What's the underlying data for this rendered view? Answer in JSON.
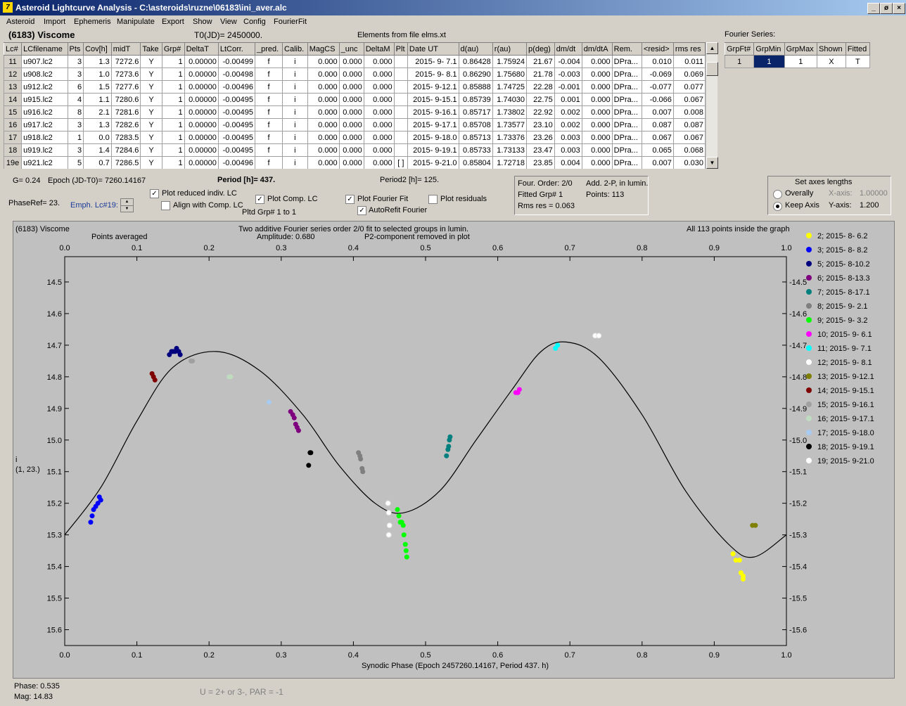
{
  "window": {
    "title": "Asteroid Lightcurve Analysis - C:\\asteroids\\ruzne\\06183\\ini_aver.alc",
    "app_icon": "7",
    "controls": [
      "_",
      "ø",
      "×"
    ]
  },
  "menu": [
    "Asteroid",
    "Import",
    "Ephemeris",
    "Manipulate",
    "Export",
    "Show",
    "View",
    "Config",
    "FourierFit"
  ],
  "header": {
    "asteroid_name": "(6183) Viscome",
    "t0": "T0(JD)= 2450000.",
    "elements": "Elements from file elms.xt",
    "fourier_series_label": "Fourier Series:"
  },
  "lc_table": {
    "columns": [
      "Lc#",
      "LCfilename",
      "Pts",
      "Cov[h]",
      "midT",
      "Take",
      "Grp#",
      "DeltaT",
      "LtCorr.",
      "_pred.",
      "Calib.",
      "MagCS",
      "_unc",
      "DeltaM",
      "Plt",
      "Date UT",
      "d(au)",
      "r(au)",
      "p(deg)",
      "dm/dt",
      "dm/dtA",
      "Rem.",
      "<resid>",
      "rms res"
    ],
    "rows": [
      [
        "11",
        "u907.lc2",
        "3",
        "1.3",
        "7272.6",
        "Y",
        "1",
        "0.00000",
        "-0.00499",
        "f",
        "i",
        "0.000",
        "0.000",
        "0.000",
        "",
        "2015- 9- 7.1",
        "0.86428",
        "1.75924",
        "21.67",
        "-0.004",
        "0.000",
        "DPra...",
        "0.010",
        "0.011"
      ],
      [
        "12",
        "u908.lc2",
        "3",
        "1.0",
        "7273.6",
        "Y",
        "1",
        "0.00000",
        "-0.00498",
        "f",
        "i",
        "0.000",
        "0.000",
        "0.000",
        "",
        "2015- 9- 8.1",
        "0.86290",
        "1.75680",
        "21.78",
        "-0.003",
        "0.000",
        "DPra...",
        "-0.069",
        "0.069"
      ],
      [
        "13",
        "u912.lc2",
        "6",
        "1.5",
        "7277.6",
        "Y",
        "1",
        "0.00000",
        "-0.00496",
        "f",
        "i",
        "0.000",
        "0.000",
        "0.000",
        "",
        "2015- 9-12.1",
        "0.85888",
        "1.74725",
        "22.28",
        "-0.001",
        "0.000",
        "DPra...",
        "-0.077",
        "0.077"
      ],
      [
        "14",
        "u915.lc2",
        "4",
        "1.1",
        "7280.6",
        "Y",
        "1",
        "0.00000",
        "-0.00495",
        "f",
        "i",
        "0.000",
        "0.000",
        "0.000",
        "",
        "2015- 9-15.1",
        "0.85739",
        "1.74030",
        "22.75",
        "0.001",
        "0.000",
        "DPra...",
        "-0.066",
        "0.067"
      ],
      [
        "15",
        "u916.lc2",
        "8",
        "2.1",
        "7281.6",
        "Y",
        "1",
        "0.00000",
        "-0.00495",
        "f",
        "i",
        "0.000",
        "0.000",
        "0.000",
        "",
        "2015- 9-16.1",
        "0.85717",
        "1.73802",
        "22.92",
        "0.002",
        "0.000",
        "DPra...",
        "0.007",
        "0.008"
      ],
      [
        "16",
        "u917.lc2",
        "3",
        "1.3",
        "7282.6",
        "Y",
        "1",
        "0.00000",
        "-0.00495",
        "f",
        "i",
        "0.000",
        "0.000",
        "0.000",
        "",
        "2015- 9-17.1",
        "0.85708",
        "1.73577",
        "23.10",
        "0.002",
        "0.000",
        "DPra...",
        "0.087",
        "0.087"
      ],
      [
        "17",
        "u918.lc2",
        "1",
        "0.0",
        "7283.5",
        "Y",
        "1",
        "0.00000",
        "-0.00495",
        "f",
        "i",
        "0.000",
        "0.000",
        "0.000",
        "",
        "2015- 9-18.0",
        "0.85713",
        "1.73376",
        "23.26",
        "0.003",
        "0.000",
        "DPra...",
        "0.067",
        "0.067"
      ],
      [
        "18",
        "u919.lc2",
        "3",
        "1.4",
        "7284.6",
        "Y",
        "1",
        "0.00000",
        "-0.00495",
        "f",
        "i",
        "0.000",
        "0.000",
        "0.000",
        "",
        "2015- 9-19.1",
        "0.85733",
        "1.73133",
        "23.47",
        "0.003",
        "0.000",
        "DPra...",
        "0.065",
        "0.068"
      ],
      [
        "19e",
        "u921.lc2",
        "5",
        "0.7",
        "7286.5",
        "Y",
        "1",
        "0.00000",
        "-0.00496",
        "f",
        "i",
        "0.000",
        "0.000",
        "0.000",
        "[ ]",
        "2015- 9-21.0",
        "0.85804",
        "1.72718",
        "23.85",
        "0.004",
        "0.000",
        "DPra...",
        "0.007",
        "0.030"
      ]
    ]
  },
  "fourier_table": {
    "columns": [
      "GrpFt#",
      "GrpMin",
      "GrpMax",
      "Shown",
      "Fitted"
    ],
    "row": [
      "1",
      "1",
      "1",
      "X",
      "T"
    ]
  },
  "params": {
    "g": "G= 0.24",
    "epoch": "Epoch (JD-T0)= 7260.14167",
    "period": "Period [h]= 437.",
    "period2": "Period2 [h]= 125.",
    "phaseref": "PhaseRef= 23.",
    "emph": "Emph. Lc#19:",
    "plot_reduced": "Plot reduced indiv. LC",
    "align": "Align with Comp. LC",
    "plot_comp": "Plot Comp. LC",
    "pltd_grp": "Pltd Grp#  1   to   1",
    "plot_fourier": "Plot Fourier Fit",
    "autorefit": "AutoRefit Fourier",
    "plot_resid": "Plot residuals"
  },
  "fit_info": {
    "four_order": "Four. Order:  2/0",
    "add": "Add. 2-P, in lumin.",
    "fitted_grp": "Fitted Grp# 1",
    "points": "Points: 113",
    "rms": "Rms res     = 0.063"
  },
  "axes_box": {
    "title": "Set axes lengths",
    "overally": "Overally",
    "keep_axis": "Keep Axis",
    "x_axis_label": "X-axis:",
    "x_axis_value": "1.00000",
    "y_axis_label": "Y-axis:",
    "y_axis_value": "1.200"
  },
  "plot": {
    "name": "(6183) Viscome",
    "points_averaged": "Points averaged",
    "info_line1": "Two additive Fourier series order 2/0 fit to selected groups in lumin.",
    "info_line2": "Amplitude: 0.680",
    "info_line3": "P2-component removed in plot",
    "all_inside": "All 113 points inside the graph",
    "y_label": "i",
    "y_label2": "(1, 23.)",
    "x_label": "Synodic Phase (Epoch 2457260.14167, Period 437. h)"
  },
  "status": {
    "phase": "Phase:  0.535",
    "mag": "Mag:   14.83",
    "u": "U = 2+ or 3-, PAR = -1"
  },
  "chart_data": {
    "type": "scatter",
    "title": "Two additive Fourier series order 2/0 fit to selected groups in lumin.",
    "xlabel": "Synodic Phase (Epoch 2457260.14167, Period 437. h)",
    "ylabel": "i",
    "xlim": [
      0,
      1
    ],
    "ylim": [
      15.65,
      14.42
    ],
    "y_inverted": true,
    "x_ticks": [
      "0.0",
      "0.1",
      "0.2",
      "0.3",
      "0.4",
      "0.5",
      "0.6",
      "0.7",
      "0.8",
      "0.9",
      "1.0"
    ],
    "y_ticks": [
      "14.5",
      "14.6",
      "14.7",
      "14.8",
      "14.9",
      "15.0",
      "15.1",
      "15.2",
      "15.3",
      "15.4",
      "15.5",
      "15.6"
    ],
    "legend_placement": "right",
    "fit_curve": {
      "mean": 15.045,
      "harmonics": [
        [
          -0.119,
          0.0
        ],
        [
          -0.145,
          0.0
        ],
        [
          0.0,
          0.0
        ]
      ],
      "comment_free": true
    },
    "fit_curve_points": [
      [
        0.0,
        15.3
      ],
      [
        0.05,
        15.15
      ],
      [
        0.1,
        14.94
      ],
      [
        0.15,
        14.77
      ],
      [
        0.21,
        14.72
      ],
      [
        0.27,
        14.78
      ],
      [
        0.33,
        14.92
      ],
      [
        0.38,
        15.08
      ],
      [
        0.43,
        15.2
      ],
      [
        0.47,
        15.23
      ],
      [
        0.52,
        15.16
      ],
      [
        0.57,
        15.0
      ],
      [
        0.62,
        14.84
      ],
      [
        0.66,
        14.72
      ],
      [
        0.695,
        14.69
      ],
      [
        0.74,
        14.74
      ],
      [
        0.8,
        14.92
      ],
      [
        0.86,
        15.16
      ],
      [
        0.92,
        15.33
      ],
      [
        0.955,
        15.37
      ],
      [
        1.0,
        15.3
      ]
    ],
    "series": [
      {
        "name": "2; 2015- 8- 6.2",
        "color": "#ffff00",
        "points": [
          [
            0.926,
            15.36
          ],
          [
            0.93,
            15.38
          ],
          [
            0.935,
            15.38
          ],
          [
            0.937,
            15.42
          ],
          [
            0.94,
            15.43
          ],
          [
            0.94,
            15.44
          ]
        ]
      },
      {
        "name": "3; 2015- 8- 8.2",
        "color": "#0000ff",
        "points": [
          [
            0.036,
            15.26
          ],
          [
            0.038,
            15.24
          ],
          [
            0.04,
            15.22
          ],
          [
            0.043,
            15.21
          ],
          [
            0.046,
            15.2
          ],
          [
            0.048,
            15.18
          ],
          [
            0.05,
            15.19
          ]
        ]
      },
      {
        "name": "5; 2015- 8-10.2",
        "color": "#00007f",
        "points": [
          [
            0.145,
            14.73
          ],
          [
            0.148,
            14.72
          ],
          [
            0.15,
            14.72
          ],
          [
            0.153,
            14.72
          ],
          [
            0.155,
            14.71
          ],
          [
            0.158,
            14.72
          ],
          [
            0.16,
            14.73
          ]
        ]
      },
      {
        "name": "6; 2015- 8-13.3",
        "color": "#7f007f",
        "points": [
          [
            0.313,
            14.91
          ],
          [
            0.316,
            14.92
          ],
          [
            0.318,
            14.93
          ],
          [
            0.32,
            14.95
          ],
          [
            0.322,
            14.96
          ],
          [
            0.324,
            14.97
          ]
        ]
      },
      {
        "name": "7; 2015- 8-17.1",
        "color": "#007f7f",
        "points": [
          [
            0.529,
            15.05
          ],
          [
            0.531,
            15.03
          ],
          [
            0.532,
            15.02
          ],
          [
            0.533,
            15.0
          ],
          [
            0.534,
            14.99
          ]
        ]
      },
      {
        "name": "8; 2015- 9- 2.1",
        "color": "#7f7f7f",
        "points": [
          [
            0.407,
            15.04
          ],
          [
            0.409,
            15.05
          ],
          [
            0.41,
            15.06
          ],
          [
            0.412,
            15.09
          ],
          [
            0.413,
            15.1
          ]
        ]
      },
      {
        "name": "9; 2015- 9- 3.2",
        "color": "#00ff00",
        "points": [
          [
            0.461,
            15.22
          ],
          [
            0.463,
            15.24
          ],
          [
            0.465,
            15.26
          ],
          [
            0.467,
            15.26
          ],
          [
            0.469,
            15.27
          ],
          [
            0.47,
            15.3
          ],
          [
            0.472,
            15.33
          ],
          [
            0.473,
            15.35
          ],
          [
            0.474,
            15.37
          ]
        ]
      },
      {
        "name": "10; 2015- 9- 6.1",
        "color": "#ff00ff",
        "points": [
          [
            0.625,
            14.85
          ],
          [
            0.628,
            14.85
          ],
          [
            0.63,
            14.84
          ]
        ]
      },
      {
        "name": "11; 2015- 9- 7.1",
        "color": "#00ffff",
        "points": [
          [
            0.68,
            14.71
          ],
          [
            0.683,
            14.7
          ]
        ]
      },
      {
        "name": "12; 2015- 9- 8.1",
        "color": "#ffffff",
        "points": [
          [
            0.448,
            15.2
          ],
          [
            0.449,
            15.23
          ],
          [
            0.45,
            15.27
          ],
          [
            0.449,
            15.3
          ]
        ]
      },
      {
        "name": "13; 2015- 9-12.1",
        "color": "#7f7f00",
        "points": [
          [
            0.953,
            15.27
          ],
          [
            0.957,
            15.27
          ]
        ]
      },
      {
        "name": "14; 2015- 9-15.1",
        "color": "#7f0000",
        "points": [
          [
            0.121,
            14.79
          ],
          [
            0.123,
            14.8
          ],
          [
            0.125,
            14.81
          ]
        ]
      },
      {
        "name": "15; 2015- 9-16.1",
        "color": "#a0a0a0",
        "points": [
          [
            0.175,
            14.75
          ],
          [
            0.177,
            14.75
          ]
        ]
      },
      {
        "name": "16; 2015- 9-17.1",
        "color": "#c0dcc0",
        "points": [
          [
            0.228,
            14.8
          ],
          [
            0.23,
            14.8
          ]
        ]
      },
      {
        "name": "17; 2015- 9-18.0",
        "color": "#a6caf0",
        "points": [
          [
            0.283,
            14.88
          ]
        ]
      },
      {
        "name": "18; 2015- 9-19.1",
        "color": "#000000",
        "points": [
          [
            0.34,
            15.04
          ],
          [
            0.341,
            15.04
          ],
          [
            0.338,
            15.08
          ]
        ]
      },
      {
        "name": "19; 2015- 9-21.0",
        "color": "#ffffff",
        "points": [
          [
            0.735,
            14.67
          ],
          [
            0.74,
            14.67
          ]
        ]
      }
    ]
  }
}
